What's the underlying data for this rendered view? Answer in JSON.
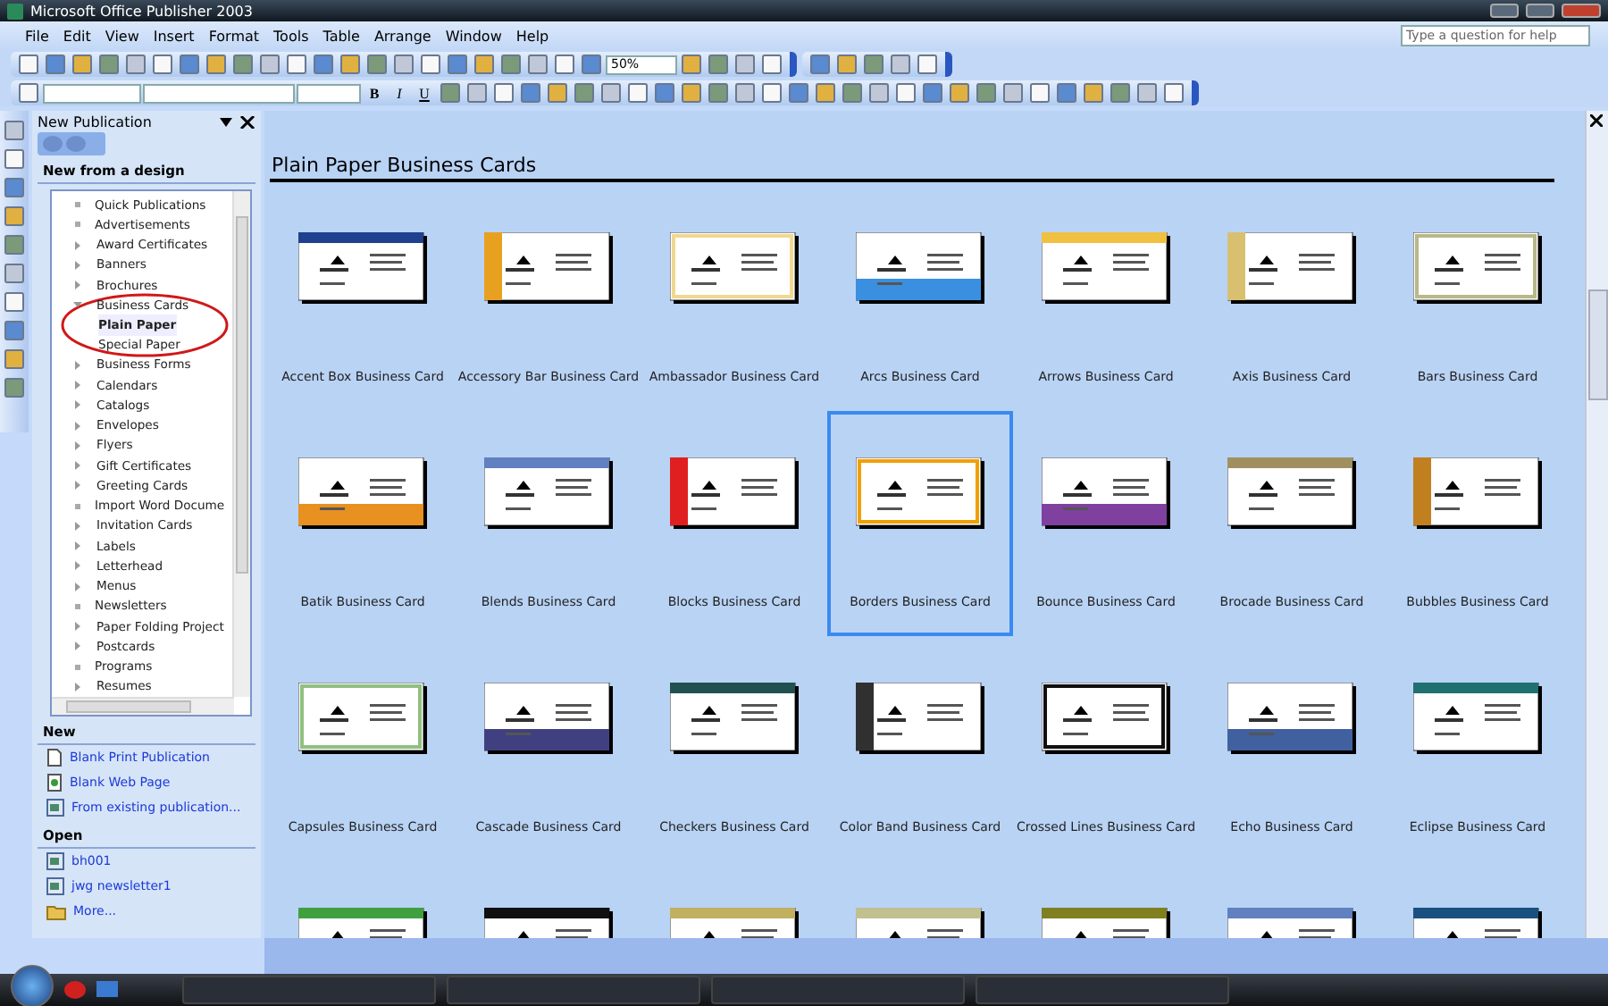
{
  "window": {
    "title": "Microsoft Office Publisher 2003"
  },
  "menus": [
    "File",
    "Edit",
    "View",
    "Insert",
    "Format",
    "Tools",
    "Table",
    "Arrange",
    "Window",
    "Help"
  ],
  "help_box": {
    "placeholder": "Type a question for help"
  },
  "standard_toolbar": {
    "zoom": "50%"
  },
  "format_toolbar": {
    "buttons": [
      "B",
      "I",
      "U"
    ]
  },
  "task_pane": {
    "title": "New Publication",
    "section": "New from a design",
    "tree": [
      {
        "label": "Quick Publications",
        "expandable": false,
        "selected": false
      },
      {
        "label": "Advertisements",
        "expandable": false,
        "selected": false
      },
      {
        "label": "Award Certificates",
        "expandable": true,
        "selected": false
      },
      {
        "label": "Banners",
        "expandable": true,
        "selected": false
      },
      {
        "label": "Brochures",
        "expandable": true,
        "selected": false
      },
      {
        "label": "Business Cards",
        "expandable": true,
        "selected": false,
        "children": [
          {
            "label": "Plain Paper",
            "selected": true
          },
          {
            "label": "Special Paper",
            "selected": false
          }
        ]
      },
      {
        "label": "Business Forms",
        "expandable": true,
        "selected": false
      },
      {
        "label": "Calendars",
        "expandable": true,
        "selected": false
      },
      {
        "label": "Catalogs",
        "expandable": true,
        "selected": false
      },
      {
        "label": "Envelopes",
        "expandable": true,
        "selected": false
      },
      {
        "label": "Flyers",
        "expandable": true,
        "selected": false
      },
      {
        "label": "Gift Certificates",
        "expandable": true,
        "selected": false
      },
      {
        "label": "Greeting Cards",
        "expandable": true,
        "selected": false
      },
      {
        "label": "Import Word Docume",
        "expandable": false,
        "selected": false
      },
      {
        "label": "Invitation Cards",
        "expandable": true,
        "selected": false
      },
      {
        "label": "Labels",
        "expandable": true,
        "selected": false
      },
      {
        "label": "Letterhead",
        "expandable": true,
        "selected": false
      },
      {
        "label": "Menus",
        "expandable": true,
        "selected": false
      },
      {
        "label": "Newsletters",
        "expandable": false,
        "selected": false
      },
      {
        "label": "Paper Folding Project",
        "expandable": true,
        "selected": false
      },
      {
        "label": "Postcards",
        "expandable": true,
        "selected": false
      },
      {
        "label": "Programs",
        "expandable": false,
        "selected": false
      },
      {
        "label": "Resumes",
        "expandable": true,
        "selected": false
      }
    ],
    "new_heading": "New",
    "new_links": [
      {
        "label": "Blank Print Publication",
        "kind": "page"
      },
      {
        "label": "Blank Web Page",
        "kind": "web"
      },
      {
        "label": "From existing publication...",
        "kind": "publication"
      }
    ],
    "open_heading": "Open",
    "open_links": [
      {
        "label": "bh001",
        "kind": "publication"
      },
      {
        "label": "jwg newsletter1",
        "kind": "publication"
      },
      {
        "label": "More...",
        "kind": "folder"
      }
    ]
  },
  "gallery": {
    "title": "Plain Paper Business Cards",
    "items": [
      {
        "label": "Accent Box Business Card",
        "selected": false,
        "color": "#1f3f8f"
      },
      {
        "label": "Accessory Bar Business Card",
        "selected": false,
        "color": "#e8a020"
      },
      {
        "label": "Ambassador Business Card",
        "selected": false,
        "color": "#f0d890"
      },
      {
        "label": "Arcs Business Card",
        "selected": false,
        "color": "#3a8fe0"
      },
      {
        "label": "Arrows Business Card",
        "selected": false,
        "color": "#f0c040"
      },
      {
        "label": "Axis Business Card",
        "selected": false,
        "color": "#d8c070"
      },
      {
        "label": "Bars Business Card",
        "selected": false,
        "color": "#b8b888"
      },
      {
        "label": "Batik Business Card",
        "selected": false,
        "color": "#e89020"
      },
      {
        "label": "Blends Business Card",
        "selected": false,
        "color": "#6080c0"
      },
      {
        "label": "Blocks Business Card",
        "selected": false,
        "color": "#e02020"
      },
      {
        "label": "Borders Business Card",
        "selected": true,
        "color": "#f0a000"
      },
      {
        "label": "Bounce Business Card",
        "selected": false,
        "color": "#8040a0"
      },
      {
        "label": "Brocade Business Card",
        "selected": false,
        "color": "#a09060"
      },
      {
        "label": "Bubbles Business Card",
        "selected": false,
        "color": "#c08020"
      },
      {
        "label": "Capsules Business Card",
        "selected": false,
        "color": "#90c080"
      },
      {
        "label": "Cascade Business Card",
        "selected": false,
        "color": "#404080"
      },
      {
        "label": "Checkers Business Card",
        "selected": false,
        "color": "#205050"
      },
      {
        "label": "Color Band Business Card",
        "selected": false,
        "color": "#303030"
      },
      {
        "label": "Crossed Lines Business Card",
        "selected": false,
        "color": "#101010"
      },
      {
        "label": "Echo Business Card",
        "selected": false,
        "color": "#4060a0"
      },
      {
        "label": "Eclipse Business Card",
        "selected": false,
        "color": "#207070"
      }
    ],
    "partial_row": [
      {
        "color": "#40a040"
      },
      {
        "color": "#101010"
      },
      {
        "color": "#c0b060"
      },
      {
        "color": "#c0c090"
      },
      {
        "color": "#808020"
      },
      {
        "color": "#6080c0"
      },
      {
        "color": "#1a5080"
      }
    ]
  }
}
